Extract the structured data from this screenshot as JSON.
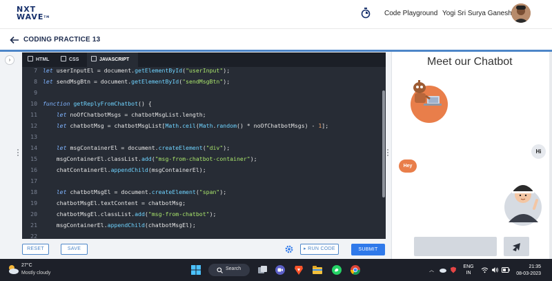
{
  "app": {
    "logo_line1": "NXT",
    "logo_line2": "WAVE",
    "logo_tm": "TM",
    "playground_label": "Code Playground",
    "user_name": "Yogi Sri Surya Ganesh"
  },
  "header": {
    "title": "CODING PRACTICE 13"
  },
  "editor": {
    "tabs": [
      {
        "label": "HTML",
        "active": false
      },
      {
        "label": "CSS",
        "active": false
      },
      {
        "label": "JAVASCRIPT",
        "active": true
      }
    ],
    "lines": [
      {
        "n": "7",
        "code": "let userInputEl = document.getElementById(\"userInput\");"
      },
      {
        "n": "8",
        "code": "let sendMsgBtn = document.getElementById(\"sendMsgBtn\");"
      },
      {
        "n": "9",
        "code": ""
      },
      {
        "n": "10",
        "code": "function getReplyFromChatbot() {"
      },
      {
        "n": "11",
        "code": "    let noOfChatbotMsgs = chatbotMsgList.length;"
      },
      {
        "n": "12",
        "code": "    let chatbotMsg = chatbotMsgList[Math.ceil(Math.random() * noOfChatbotMsgs) - 1];"
      },
      {
        "n": "13",
        "code": ""
      },
      {
        "n": "14",
        "code": "    let msgContainerEl = document.createElement(\"div\");"
      },
      {
        "n": "15",
        "code": "    msgContainerEl.classList.add(\"msg-from-chatbot-container\");"
      },
      {
        "n": "16",
        "code": "    chatContainerEl.appendChild(msgContainerEl);"
      },
      {
        "n": "17",
        "code": ""
      },
      {
        "n": "18",
        "code": "    let chatbotMsgEl = document.createElement(\"span\");"
      },
      {
        "n": "19",
        "code": "    chatbotMsgEl.textContent = chatbotMsg;"
      },
      {
        "n": "20",
        "code": "    chatbotMsgEl.classList.add(\"msg-from-chatbot\");"
      },
      {
        "n": "21",
        "code": "    msgContainerEl.appendChild(chatbotMsgEl);"
      },
      {
        "n": "22",
        "code": ""
      }
    ],
    "reset_label": "RESET",
    "save_label": "SAVE",
    "run_label": "RUN CODE",
    "submit_label": "SUBMIT"
  },
  "preview": {
    "title": "Meet our Chatbot",
    "user_msg": "Hi",
    "bot_msg": "Hey",
    "input_value": ""
  },
  "taskbar": {
    "temperature": "27°C",
    "weather": "Mostly cloudy",
    "search_label": "Search",
    "lang_line1": "ENG",
    "lang_line2": "IN",
    "time": "21:35",
    "date": "08-03-2023"
  },
  "colors": {
    "accent": "#2f79ea",
    "editor_bg": "#272c35",
    "bot_bubble": "#e97e4a",
    "taskbar_bg": "#1d2029"
  }
}
